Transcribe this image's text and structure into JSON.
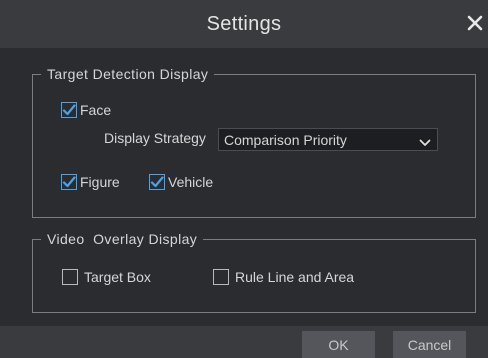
{
  "dialog": {
    "title": "Settings",
    "close_icon": "close-icon"
  },
  "target_detection": {
    "legend": "Target Detection Display",
    "face": {
      "label": "Face",
      "checked": true
    },
    "display_strategy": {
      "label": "Display Strategy",
      "value": "Comparison Priority"
    },
    "figure": {
      "label": "Figure",
      "checked": true
    },
    "vehicle": {
      "label": "Vehicle",
      "checked": true
    }
  },
  "video_overlay": {
    "legend": "Video  Overlay Display",
    "target_box": {
      "label": "Target Box",
      "checked": false
    },
    "rule_line": {
      "label": "Rule Line and Area",
      "checked": false
    }
  },
  "buttons": {
    "ok": "OK",
    "cancel": "Cancel"
  },
  "colors": {
    "background": "#2b2c30",
    "titlebar": "#3a3b3f",
    "check_accent": "#4aa3ea"
  }
}
